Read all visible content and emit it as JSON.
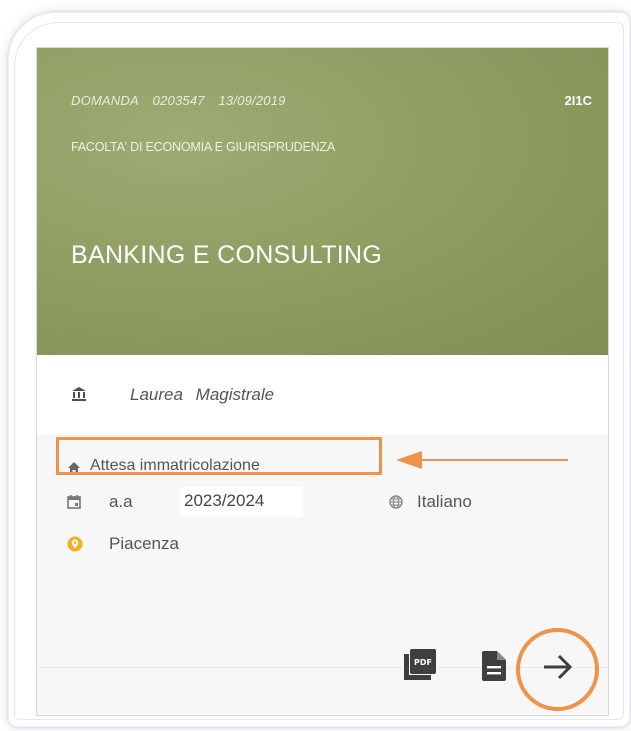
{
  "card": {
    "application_label": "DOMANDA",
    "application_number": "0203547",
    "application_date": "13/09/2019",
    "code": "2I1C",
    "faculty": "FACOLTA' DI ECONOMIA E GIURISPRUDENZA",
    "course_title": "BANKING E CONSULTING",
    "degree_type": "Laurea",
    "degree_level": "Magistrale",
    "status": "Attesa immatricolazione",
    "year_prefix": "a.a",
    "academic_year": "2023/2024",
    "language": "Italiano",
    "location": "Piacenza"
  },
  "icons": {
    "degree": "bank-icon",
    "status": "home-icon",
    "year": "calendar-icon",
    "language": "globe-icon",
    "location": "map-pin-icon",
    "pdf": "pdf-icon",
    "document": "document-icon",
    "next": "arrow-right-icon"
  },
  "colors": {
    "header_green": "#8f9e62",
    "highlight_orange": "#f0924a",
    "location_pin": "#f3b21b",
    "icon_dark": "#4d4d4d"
  }
}
